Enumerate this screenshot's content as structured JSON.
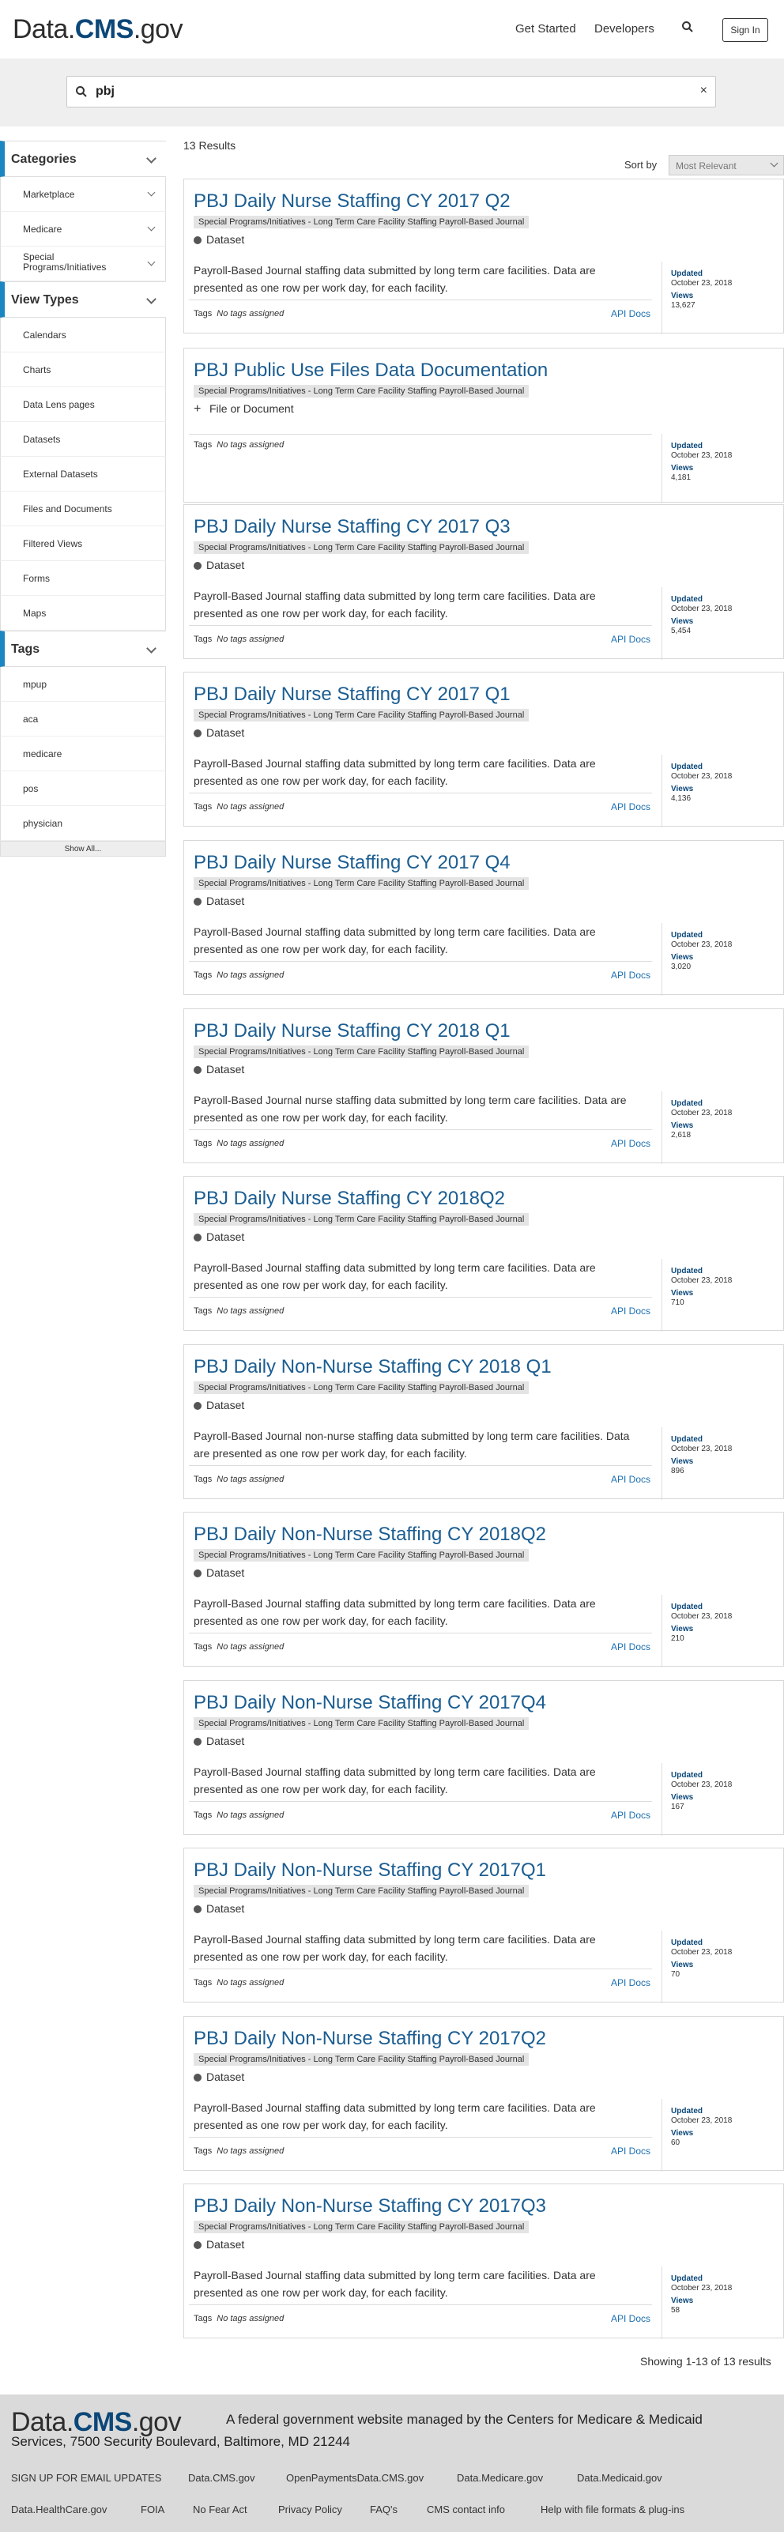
{
  "header": {
    "logo_prefix": "Data.",
    "logo_brand": "CMS",
    "logo_suffix": ".gov",
    "nav": [
      "Get Started",
      "Developers"
    ],
    "sign_in": "Sign In"
  },
  "search": {
    "query": "pbj",
    "clear": "×"
  },
  "sidebar": {
    "categories": {
      "title": "Categories",
      "items": [
        "Marketplace",
        "Medicare",
        "Special Programs/Initiatives"
      ]
    },
    "view_types": {
      "title": "View Types",
      "items": [
        "Calendars",
        "Charts",
        "Data Lens pages",
        "Datasets",
        "External Datasets",
        "Files and Documents",
        "Filtered Views",
        "Forms",
        "Maps"
      ]
    },
    "tags": {
      "title": "Tags",
      "items": [
        "mpup",
        "aca",
        "medicare",
        "pos",
        "physician"
      ],
      "show_all": "Show All..."
    }
  },
  "results_header": {
    "count": "13 Results",
    "sort_label": "Sort by",
    "sort_value": "Most Relevant"
  },
  "common": {
    "category": "Special Programs/Initiatives - Long Term Care Facility Staffing Payroll-Based Journal",
    "tags_label": "Tags",
    "no_tags": "No tags assigned",
    "api_docs": "API Docs",
    "updated_label": "Updated",
    "views_label": "Views"
  },
  "results": [
    {
      "title": "PBJ Daily Nurse Staffing CY 2017 Q2",
      "type": "Dataset",
      "desc": "Payroll-Based Journal staffing data submitted by long term care facilities. Data are presented as one row per work day, for each facility.",
      "updated": "October 23, 2018",
      "views": "13,627"
    },
    {
      "title": "PBJ Public Use Files Data Documentation",
      "type": "File or Document",
      "desc": "",
      "updated": "October 23, 2018",
      "views": "4,181"
    },
    {
      "title": "PBJ Daily Nurse Staffing CY 2017 Q3",
      "type": "Dataset",
      "desc": "Payroll-Based Journal staffing data submitted by long term care facilities. Data are presented as one row per work day, for each facility.",
      "updated": "October 23, 2018",
      "views": "5,454"
    },
    {
      "title": "PBJ Daily Nurse Staffing CY 2017 Q1",
      "type": "Dataset",
      "desc": "Payroll-Based Journal staffing data submitted by long term care facilities. Data are presented as one row per work day, for each facility.",
      "updated": "October 23, 2018",
      "views": "4,136"
    },
    {
      "title": "PBJ Daily Nurse Staffing CY 2017 Q4",
      "type": "Dataset",
      "desc": "Payroll-Based Journal staffing data submitted by long term care facilities. Data are presented as one row per work day, for each facility.",
      "updated": "October 23, 2018",
      "views": "3,020"
    },
    {
      "title": "PBJ Daily Nurse Staffing CY 2018 Q1",
      "type": "Dataset",
      "desc": "Payroll-Based Journal nurse staffing data submitted by long term care facilities. Data are presented as one row per work day, for each facility.",
      "updated": "October 23, 2018",
      "views": "2,618"
    },
    {
      "title": "PBJ Daily Nurse Staffing CY 2018Q2",
      "type": "Dataset",
      "desc": "Payroll-Based Journal staffing data submitted by long term care facilities. Data are presented as one row per work day, for each facility.",
      "updated": "October 23, 2018",
      "views": "710"
    },
    {
      "title": "PBJ Daily Non-Nurse Staffing CY 2018 Q1",
      "type": "Dataset",
      "desc": "Payroll-Based Journal non-nurse staffing data submitted by long term care facilities. Data are presented as one row per work day, for each facility.",
      "updated": "October 23, 2018",
      "views": "896"
    },
    {
      "title": "PBJ Daily Non-Nurse Staffing CY 2018Q2",
      "type": "Dataset",
      "desc": "Payroll-Based Journal staffing data submitted by long term care facilities. Data are presented as one row per work day, for each facility.",
      "updated": "October 23, 2018",
      "views": "210"
    },
    {
      "title": "PBJ Daily Non-Nurse Staffing CY 2017Q4",
      "type": "Dataset",
      "desc": "Payroll-Based Journal staffing data submitted by long term care facilities. Data are presented as one row per work day, for each facility.",
      "updated": "October 23, 2018",
      "views": "167"
    },
    {
      "title": "PBJ Daily Non-Nurse Staffing CY 2017Q1",
      "type": "Dataset",
      "desc": "Payroll-Based Journal staffing data submitted by long term care facilities. Data are presented as one row per work day, for each facility.",
      "updated": "October 23, 2018",
      "views": "70"
    },
    {
      "title": "PBJ Daily Non-Nurse Staffing CY 2017Q2",
      "type": "Dataset",
      "desc": "Payroll-Based Journal staffing data submitted by long term care facilities. Data are presented as one row per work day, for each facility.",
      "updated": "October 23, 2018",
      "views": "60"
    },
    {
      "title": "PBJ Daily Non-Nurse Staffing CY 2017Q3",
      "type": "Dataset",
      "desc": "Payroll-Based Journal staffing data submitted by long term care facilities. Data are presented as one row per work day, for each facility.",
      "updated": "October 23, 2018",
      "views": "58"
    }
  ],
  "pagination": {
    "showing": "Showing 1-13 of 13 results"
  },
  "footer": {
    "logo_prefix": "Data.",
    "logo_brand": "CMS",
    "logo_suffix": ".gov",
    "tagline_1": "A federal government website managed by the Centers for Medicare & Medicaid",
    "tagline_2": "Services, 7500 Security Boulevard, Baltimore, MD 21244",
    "links_row1": [
      "SIGN UP FOR EMAIL UPDATES",
      "Data.CMS.gov",
      "OpenPaymentsData.CMS.gov",
      "Data.Medicare.gov",
      "Data.Medicaid.gov"
    ],
    "links_row2": [
      "Data.HealthCare.gov",
      "FOIA",
      "No Fear Act",
      "Privacy Policy",
      "FAQ's",
      "CMS contact info",
      "Help with file formats & plug-ins"
    ]
  }
}
